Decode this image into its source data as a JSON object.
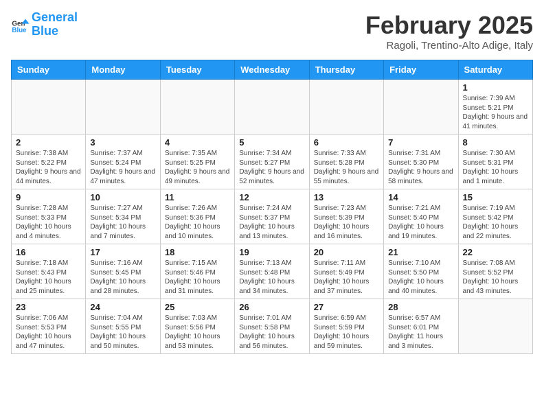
{
  "header": {
    "logo_line1": "General",
    "logo_line2": "Blue",
    "month_title": "February 2025",
    "subtitle": "Ragoli, Trentino-Alto Adige, Italy"
  },
  "weekdays": [
    "Sunday",
    "Monday",
    "Tuesday",
    "Wednesday",
    "Thursday",
    "Friday",
    "Saturday"
  ],
  "weeks": [
    [
      {
        "day": "",
        "info": ""
      },
      {
        "day": "",
        "info": ""
      },
      {
        "day": "",
        "info": ""
      },
      {
        "day": "",
        "info": ""
      },
      {
        "day": "",
        "info": ""
      },
      {
        "day": "",
        "info": ""
      },
      {
        "day": "1",
        "info": "Sunrise: 7:39 AM\nSunset: 5:21 PM\nDaylight: 9 hours and 41 minutes."
      }
    ],
    [
      {
        "day": "2",
        "info": "Sunrise: 7:38 AM\nSunset: 5:22 PM\nDaylight: 9 hours and 44 minutes."
      },
      {
        "day": "3",
        "info": "Sunrise: 7:37 AM\nSunset: 5:24 PM\nDaylight: 9 hours and 47 minutes."
      },
      {
        "day": "4",
        "info": "Sunrise: 7:35 AM\nSunset: 5:25 PM\nDaylight: 9 hours and 49 minutes."
      },
      {
        "day": "5",
        "info": "Sunrise: 7:34 AM\nSunset: 5:27 PM\nDaylight: 9 hours and 52 minutes."
      },
      {
        "day": "6",
        "info": "Sunrise: 7:33 AM\nSunset: 5:28 PM\nDaylight: 9 hours and 55 minutes."
      },
      {
        "day": "7",
        "info": "Sunrise: 7:31 AM\nSunset: 5:30 PM\nDaylight: 9 hours and 58 minutes."
      },
      {
        "day": "8",
        "info": "Sunrise: 7:30 AM\nSunset: 5:31 PM\nDaylight: 10 hours and 1 minute."
      }
    ],
    [
      {
        "day": "9",
        "info": "Sunrise: 7:28 AM\nSunset: 5:33 PM\nDaylight: 10 hours and 4 minutes."
      },
      {
        "day": "10",
        "info": "Sunrise: 7:27 AM\nSunset: 5:34 PM\nDaylight: 10 hours and 7 minutes."
      },
      {
        "day": "11",
        "info": "Sunrise: 7:26 AM\nSunset: 5:36 PM\nDaylight: 10 hours and 10 minutes."
      },
      {
        "day": "12",
        "info": "Sunrise: 7:24 AM\nSunset: 5:37 PM\nDaylight: 10 hours and 13 minutes."
      },
      {
        "day": "13",
        "info": "Sunrise: 7:23 AM\nSunset: 5:39 PM\nDaylight: 10 hours and 16 minutes."
      },
      {
        "day": "14",
        "info": "Sunrise: 7:21 AM\nSunset: 5:40 PM\nDaylight: 10 hours and 19 minutes."
      },
      {
        "day": "15",
        "info": "Sunrise: 7:19 AM\nSunset: 5:42 PM\nDaylight: 10 hours and 22 minutes."
      }
    ],
    [
      {
        "day": "16",
        "info": "Sunrise: 7:18 AM\nSunset: 5:43 PM\nDaylight: 10 hours and 25 minutes."
      },
      {
        "day": "17",
        "info": "Sunrise: 7:16 AM\nSunset: 5:45 PM\nDaylight: 10 hours and 28 minutes."
      },
      {
        "day": "18",
        "info": "Sunrise: 7:15 AM\nSunset: 5:46 PM\nDaylight: 10 hours and 31 minutes."
      },
      {
        "day": "19",
        "info": "Sunrise: 7:13 AM\nSunset: 5:48 PM\nDaylight: 10 hours and 34 minutes."
      },
      {
        "day": "20",
        "info": "Sunrise: 7:11 AM\nSunset: 5:49 PM\nDaylight: 10 hours and 37 minutes."
      },
      {
        "day": "21",
        "info": "Sunrise: 7:10 AM\nSunset: 5:50 PM\nDaylight: 10 hours and 40 minutes."
      },
      {
        "day": "22",
        "info": "Sunrise: 7:08 AM\nSunset: 5:52 PM\nDaylight: 10 hours and 43 minutes."
      }
    ],
    [
      {
        "day": "23",
        "info": "Sunrise: 7:06 AM\nSunset: 5:53 PM\nDaylight: 10 hours and 47 minutes."
      },
      {
        "day": "24",
        "info": "Sunrise: 7:04 AM\nSunset: 5:55 PM\nDaylight: 10 hours and 50 minutes."
      },
      {
        "day": "25",
        "info": "Sunrise: 7:03 AM\nSunset: 5:56 PM\nDaylight: 10 hours and 53 minutes."
      },
      {
        "day": "26",
        "info": "Sunrise: 7:01 AM\nSunset: 5:58 PM\nDaylight: 10 hours and 56 minutes."
      },
      {
        "day": "27",
        "info": "Sunrise: 6:59 AM\nSunset: 5:59 PM\nDaylight: 10 hours and 59 minutes."
      },
      {
        "day": "28",
        "info": "Sunrise: 6:57 AM\nSunset: 6:01 PM\nDaylight: 11 hours and 3 minutes."
      },
      {
        "day": "",
        "info": ""
      }
    ]
  ]
}
